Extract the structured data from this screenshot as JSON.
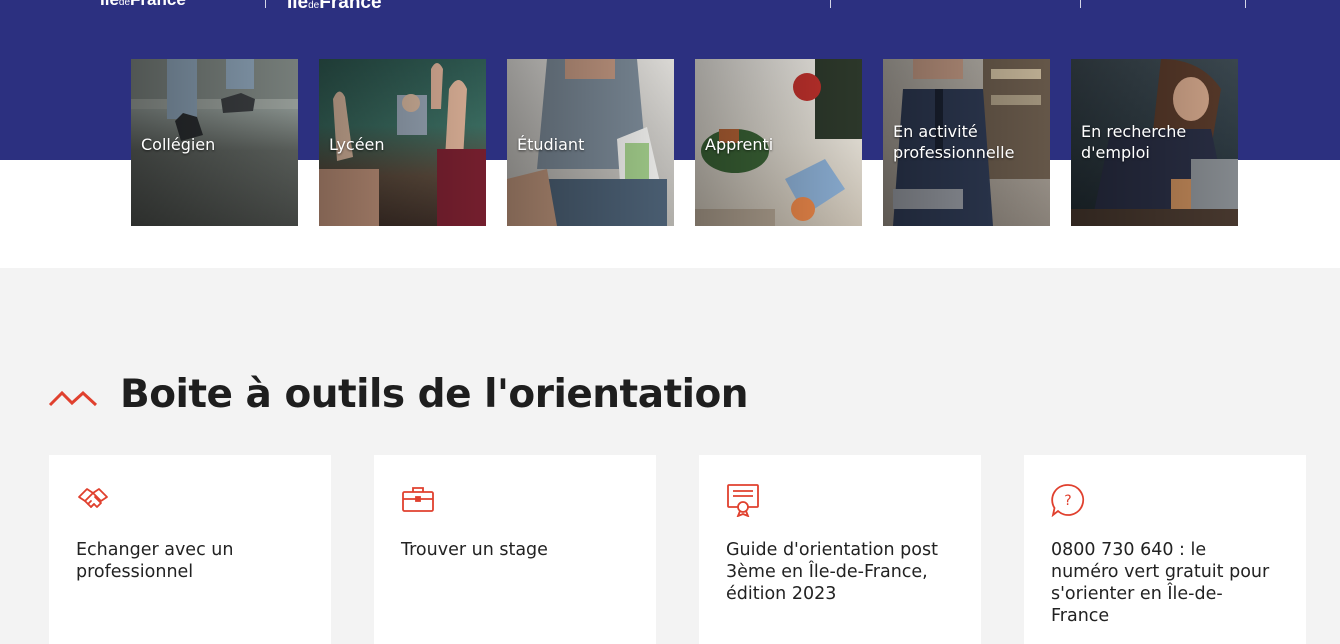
{
  "header": {
    "logo_left": {
      "name": "Île",
      "small": "de",
      "suffix": "France"
    },
    "logo_right": {
      "name": "Île",
      "small": "de",
      "suffix": "France"
    }
  },
  "profiles": [
    {
      "label": "Collégien",
      "icon": "photo-college-student"
    },
    {
      "label": "Lycéen",
      "icon": "photo-high-school-class"
    },
    {
      "label": "Étudiant",
      "icon": "photo-university-student"
    },
    {
      "label": "Apprenti",
      "icon": "photo-apprentice"
    },
    {
      "label_line1": "En activité",
      "label_line2": "professionnelle",
      "icon": "photo-professional"
    },
    {
      "label_line1": "En recherche",
      "label_line2": "d'emploi",
      "icon": "photo-job-seeker"
    }
  ],
  "toolbox": {
    "title": "Boite à outils de l'orientation",
    "cards": [
      {
        "text": "Echanger avec un professionnel",
        "icon": "handshake-icon"
      },
      {
        "text": "Trouver un stage",
        "icon": "briefcase-icon"
      },
      {
        "text": "Guide d'orientation post 3ème en Île-de-France, édition 2023",
        "icon": "certificate-icon"
      },
      {
        "text": "0800 730 640 : le numéro vert gratuit pour s'orienter en Île-de-France",
        "icon": "question-icon"
      }
    ]
  },
  "colors": {
    "brand_blue": "#2c3080",
    "accent_red": "#e0402e",
    "background": "#f3f3f3"
  }
}
